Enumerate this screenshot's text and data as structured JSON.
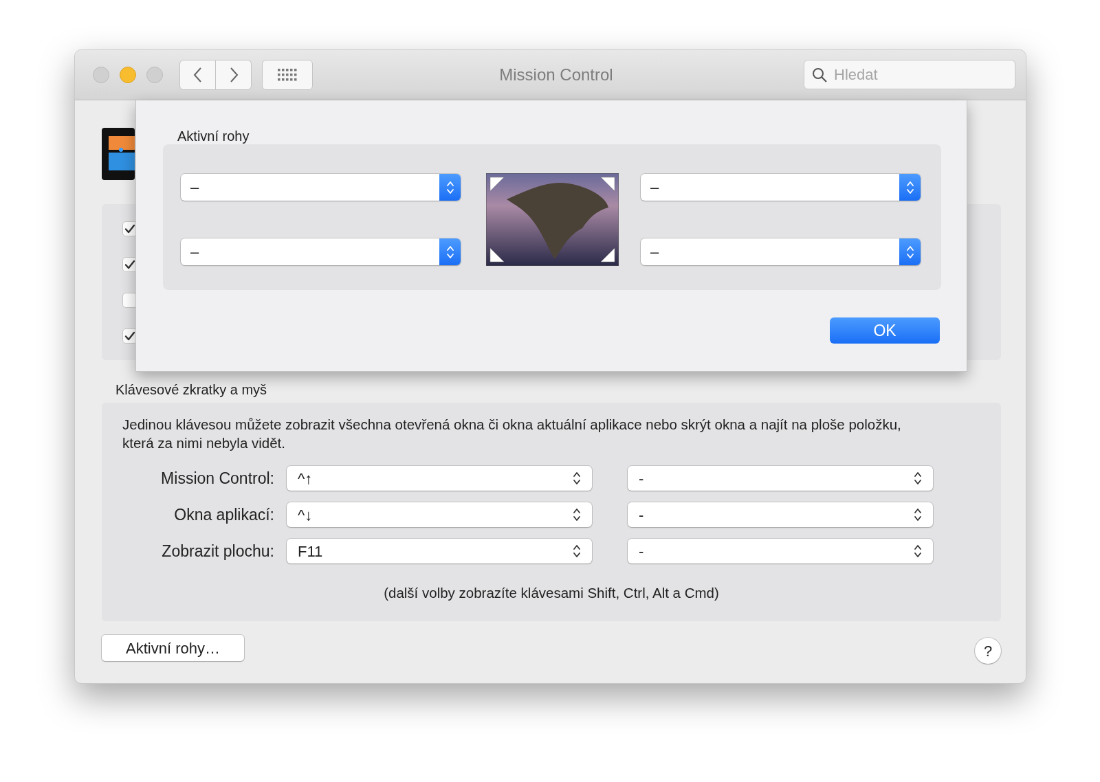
{
  "window": {
    "title": "Mission Control"
  },
  "search": {
    "placeholder": "Hledat"
  },
  "background_checkboxes": [
    {
      "checked": true
    },
    {
      "checked": true
    },
    {
      "checked": false
    },
    {
      "checked": true
    }
  ],
  "sheet": {
    "title": "Aktivní rohy",
    "corners": [
      {
        "value": "–"
      },
      {
        "value": "–"
      },
      {
        "value": "–"
      },
      {
        "value": "–"
      }
    ],
    "ok_button": "OK"
  },
  "shortcuts": {
    "title": "Klávesové zkratky a myš",
    "description": "Jedinou klávesou můžete zobrazit všechna otevřená okna či okna aktuální aplikace nebo skrýt okna a najít na ploše položku, která za nimi nebyla vidět.",
    "rows": [
      {
        "label": "Mission Control:",
        "keyboard": "^↑",
        "mouse": "-"
      },
      {
        "label": "Okna aplikací:",
        "keyboard": "^↓",
        "mouse": "-"
      },
      {
        "label": "Zobrazit plochu:",
        "keyboard": "F11",
        "mouse": "-"
      }
    ],
    "hint": "(další volby zobrazíte klávesami Shift, Ctrl, Alt a Cmd)"
  },
  "hot_corners_button": "Aktivní rohy…",
  "help_button": "?"
}
